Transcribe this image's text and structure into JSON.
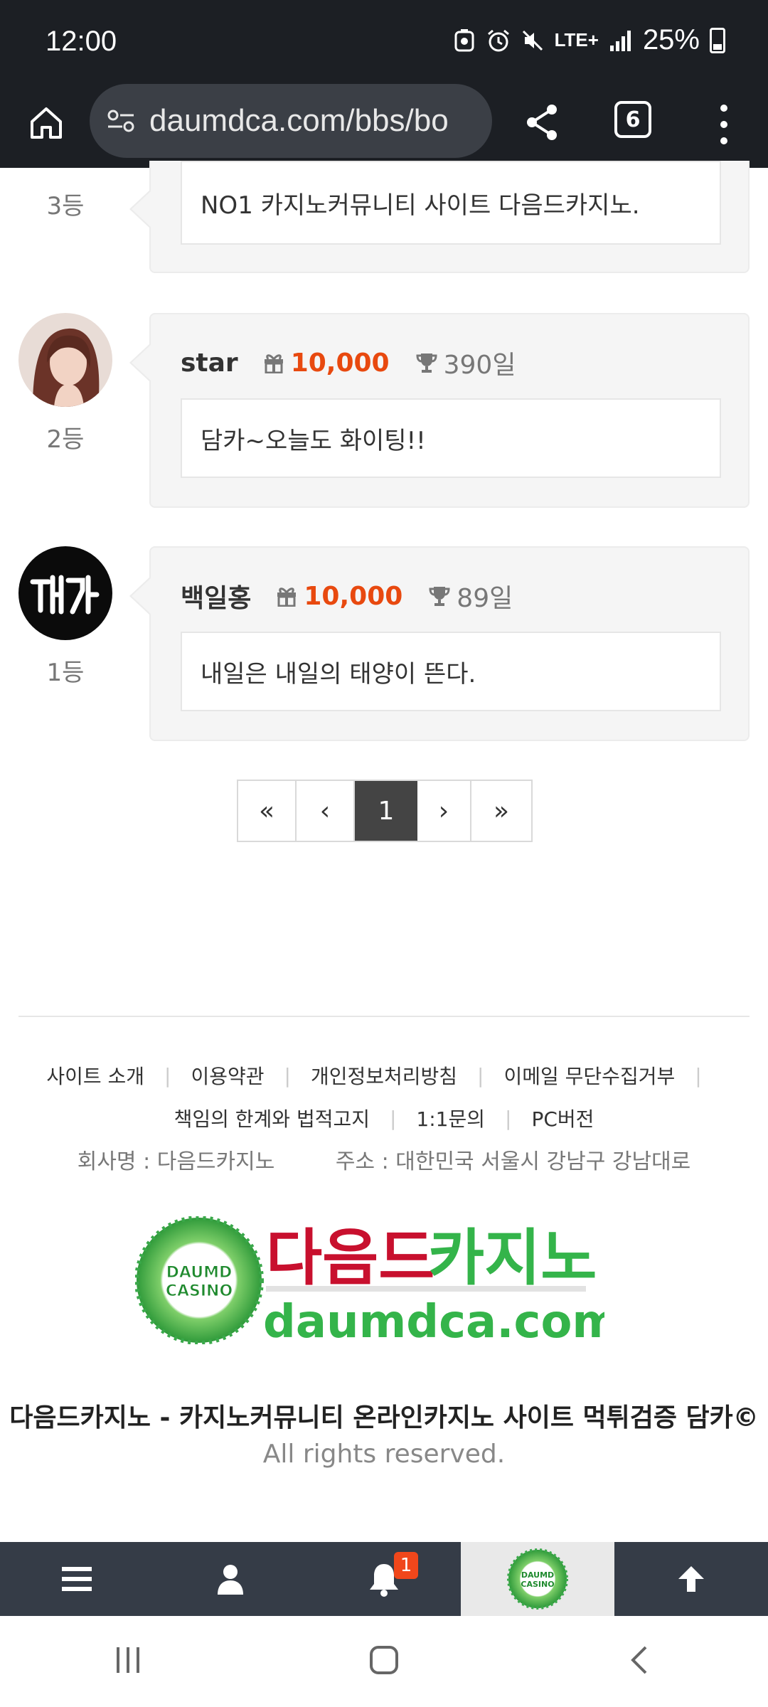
{
  "status_bar": {
    "time": "12:00",
    "network": "LTE+",
    "battery": "25%"
  },
  "browser": {
    "url": "daumdca.com/bbs/bo",
    "tab_count": "6"
  },
  "comments": [
    {
      "rank": "3등",
      "message": "NO1 카지노커뮤니티 사이트 다음드카지노."
    },
    {
      "rank": "2등",
      "author": "star",
      "points": "10,000",
      "days": "390일",
      "message": "담카~오늘도 화이팅!!"
    },
    {
      "rank": "1등",
      "author": "백일홍",
      "points": "10,000",
      "days": "89일",
      "message": "내일은 내일의 태양이 뜬다."
    }
  ],
  "pagination": {
    "first": "«",
    "prev": "‹",
    "current": "1",
    "next": "›",
    "last": "»"
  },
  "footer": {
    "links_row1": [
      "사이트 소개",
      "이용약관",
      "개인정보처리방침",
      "이메일 무단수집거부"
    ],
    "links_row2": [
      "책임의 한계와 법적고지",
      "1:1문의",
      "PC버전"
    ],
    "company": "회사명 : 다음드카지노",
    "address": "주소 : 대한민국 서울시 강남구 강남대로",
    "logo_title": "다음드카지노",
    "logo_title_part1": "다음드",
    "logo_title_part2": "카지노",
    "logo_domain": "daumdca.com",
    "logo_badge_line1": "DAUMD",
    "logo_badge_line2": "CASINO",
    "copyright": "다음드카지노 - 카지노커뮤니티 온라인카지노 사이트 먹튀검증 담카©",
    "rights": "All rights reserved."
  },
  "bottom_nav": {
    "notification_count": "1",
    "badge_line1": "DAUMD",
    "badge_line2": "CASINO"
  },
  "colors": {
    "points": "#e8490f",
    "nav_bg": "#353c47",
    "logo_red": "#c8102e",
    "logo_green": "#34b44a"
  }
}
